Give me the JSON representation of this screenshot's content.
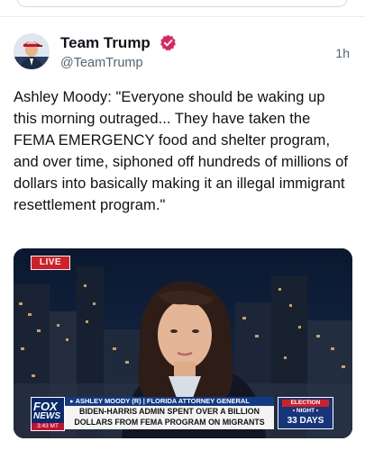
{
  "post": {
    "author_name": "Team Trump",
    "handle": "@TeamTrump",
    "time": "1h",
    "text": "Ashley Moody: \"Everyone should be waking up this morning outraged... They have taken the FEMA EMERGENCY food and shelter program, and over time, siphoned off hundreds of millions of dollars into basically making it an illegal immigrant resettlement program.\""
  },
  "video": {
    "live_badge": "LIVE",
    "network_logo_top": "FOX",
    "network_logo_bottom": "NEWS",
    "clock": "3:43 MT",
    "lower_third_top": "▸ ASHLEY MOODY (R) | FLORIDA ATTORNEY GENERAL",
    "lower_third_line1": "BIDEN-HARRIS ADMIN SPENT OVER A BILLION",
    "lower_third_line2": "DOLLARS FROM FEMA PROGRAM ON MIGRANTS",
    "election_label": "ELECTION",
    "election_night": "• NIGHT •",
    "election_days": "33 DAYS"
  },
  "colors": {
    "verified_badge": "#e0245e",
    "live_red": "#d21f25",
    "fox_blue": "#123a85"
  },
  "icons": [
    "verified-badge-icon"
  ]
}
